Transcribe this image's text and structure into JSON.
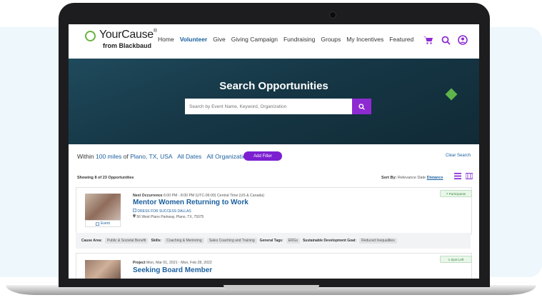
{
  "logo": {
    "name": "YourCause",
    "reg": "®",
    "sub": "from Blackbaud"
  },
  "nav": {
    "items": [
      "Home",
      "Volunteer",
      "Give",
      "Giving Campaign",
      "Fundraising",
      "Groups",
      "My Incentives",
      "Featured"
    ],
    "active": "Volunteer",
    "icons": [
      "cart-icon",
      "search-icon",
      "user-icon"
    ]
  },
  "hero": {
    "title": "Search Opportunities",
    "search_placeholder": "Search by Event Name, Keyword, Organization"
  },
  "filters": {
    "within": "Within",
    "distance": "100 miles",
    "of": "of",
    "location": "Plano, TX, USA",
    "dates": "All Dates",
    "orgs": "All Organizations",
    "add_filter": "Add Filter",
    "clear": "Clear Search"
  },
  "results": {
    "showing": "Showing 8 of 23 Opportunities",
    "sort_label": "Sort By:",
    "sort_options": [
      "Relevance",
      "Date",
      "Distance"
    ],
    "sort_selected": "Distance"
  },
  "cards": [
    {
      "occurrence_label": "Next Occurrence",
      "occurrence": "6:00 PM - 8:00 PM (UTC-06:00) Central Time (US & Canada)",
      "title": "Mentor Women Returning to Work",
      "org": "DRESS FOR SUCCESS DALLAS",
      "address": "56 West Plano Parkway, Plano, TX, 75075",
      "type": "Event",
      "badge": "7 Participants"
    },
    {
      "occurrence_label": "Project",
      "occurrence": "Mon, Mar 01, 2021 - Mon, Feb 28, 2022",
      "title": "Seeking Board Member",
      "badge": "1 Spot Left"
    }
  ],
  "tags": {
    "cause_label": "Cause Area:",
    "cause": "Public & Societal Benefit",
    "skills_label": "Skills:",
    "skills": [
      "Coaching & Mentoring",
      "Sales Coaching and Training"
    ],
    "general_label": "General Tags:",
    "general": "ERGs",
    "sdg_label": "Sustainable Development Goal:",
    "sdg": "Reduced Inequalities"
  }
}
